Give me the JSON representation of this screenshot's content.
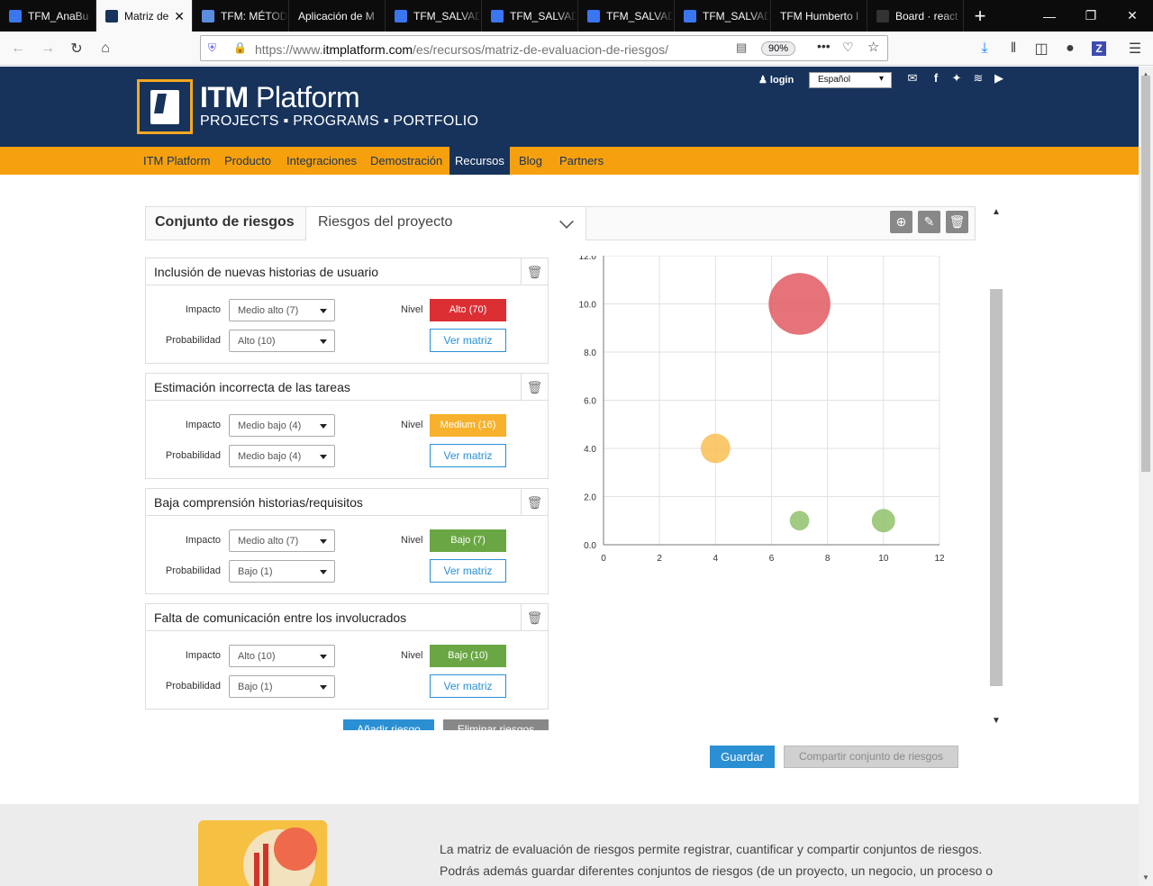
{
  "browser": {
    "tabs": [
      {
        "label": "TFM_AnaBu",
        "fav": "#3a76f0"
      },
      {
        "label": "Matriz de",
        "fav": "#17335c",
        "active": true
      },
      {
        "label": "TFM: MÉTOD",
        "fav": "#5a8de0"
      },
      {
        "label": "Aplicación de M",
        "fav": ""
      },
      {
        "label": "TFM_SALVAD",
        "fav": "#3a76f0"
      },
      {
        "label": "TFM_SALVAD",
        "fav": "#3a76f0"
      },
      {
        "label": "TFM_SALVAD",
        "fav": "#3a76f0"
      },
      {
        "label": "TFM_SALVAD",
        "fav": "#3a76f0"
      },
      {
        "label": "TFM Humberto I",
        "fav": ""
      },
      {
        "label": "Board · react",
        "fav": "#333"
      }
    ],
    "url_prefix": "https://www.",
    "url_domain": "itmplatform.com",
    "url_path": "/es/recursos/matriz-de-evaluacion-de-riesgos/",
    "zoom": "90%"
  },
  "site": {
    "logo_title_bold": "ITM",
    "logo_title_rest": " Platform",
    "logo_subtitle": "PROJECTS ▪ PROGRAMS ▪ PORTFOLIO",
    "login": "login",
    "language": "Español",
    "menu": [
      "ITM Platform",
      "Producto",
      "Integraciones",
      "Demostración",
      "Recursos",
      "Blog",
      "Partners"
    ],
    "active_menu": "Recursos"
  },
  "riskset": {
    "label": "Conjunto de riesgos",
    "selected": "Riesgos del proyecto"
  },
  "labels": {
    "impacto": "Impacto",
    "probabilidad": "Probabilidad",
    "nivel": "Nivel",
    "ver_matriz": "Ver matriz"
  },
  "risks": [
    {
      "title": "Inclusión de nuevas historias de usuario",
      "impacto": "Medio alto (7)",
      "probabilidad": "Alto (10)",
      "nivel": "Alto (70)",
      "color": "#dc2f34"
    },
    {
      "title": "Estimación incorrecta de las tareas",
      "impacto": "Medio bajo (4)",
      "probabilidad": "Medio bajo (4)",
      "nivel": "Medium (16)",
      "color": "#f7b12c"
    },
    {
      "title": "Baja comprensión historias/requisitos",
      "impacto": "Medio alto (7)",
      "probabilidad": "Bajo (1)",
      "nivel": "Bajo (7)",
      "color": "#6aa744"
    },
    {
      "title": "Falta de comunicación entre los involucrados",
      "impacto": "Alto (10)",
      "probabilidad": "Bajo (1)",
      "nivel": "Bajo (10)",
      "color": "#6aa744"
    }
  ],
  "buttons": {
    "add": "Añadir riesgo",
    "delete": "Eliminar riesgos",
    "save": "Guardar",
    "share": "Compartir conjunto de riesgos"
  },
  "chart_data": {
    "type": "scatter",
    "x_ticks": [
      "0",
      "2",
      "4",
      "6",
      "8",
      "10",
      "12"
    ],
    "y_ticks": [
      "0.0",
      "2.0",
      "4.0",
      "6.0",
      "8.0",
      "10.0",
      "12.0"
    ],
    "xlim": [
      0,
      12
    ],
    "ylim": [
      0,
      12
    ],
    "grid": true,
    "points": [
      {
        "x": 7,
        "y": 10,
        "size": 70,
        "color": "#e05a62"
      },
      {
        "x": 4,
        "y": 4,
        "size": 16,
        "color": "#f9bf55"
      },
      {
        "x": 7,
        "y": 1,
        "size": 7,
        "color": "#8fc26a"
      },
      {
        "x": 10,
        "y": 1,
        "size": 10,
        "color": "#8fc26a"
      }
    ]
  },
  "footer": {
    "line1": "La matriz de evaluación de riesgos permite registrar, cuantificar y compartir conjuntos de riesgos.",
    "line2": "Podrás además guardar diferentes conjuntos de riesgos (de un proyecto, un negocio, un proceso o"
  }
}
